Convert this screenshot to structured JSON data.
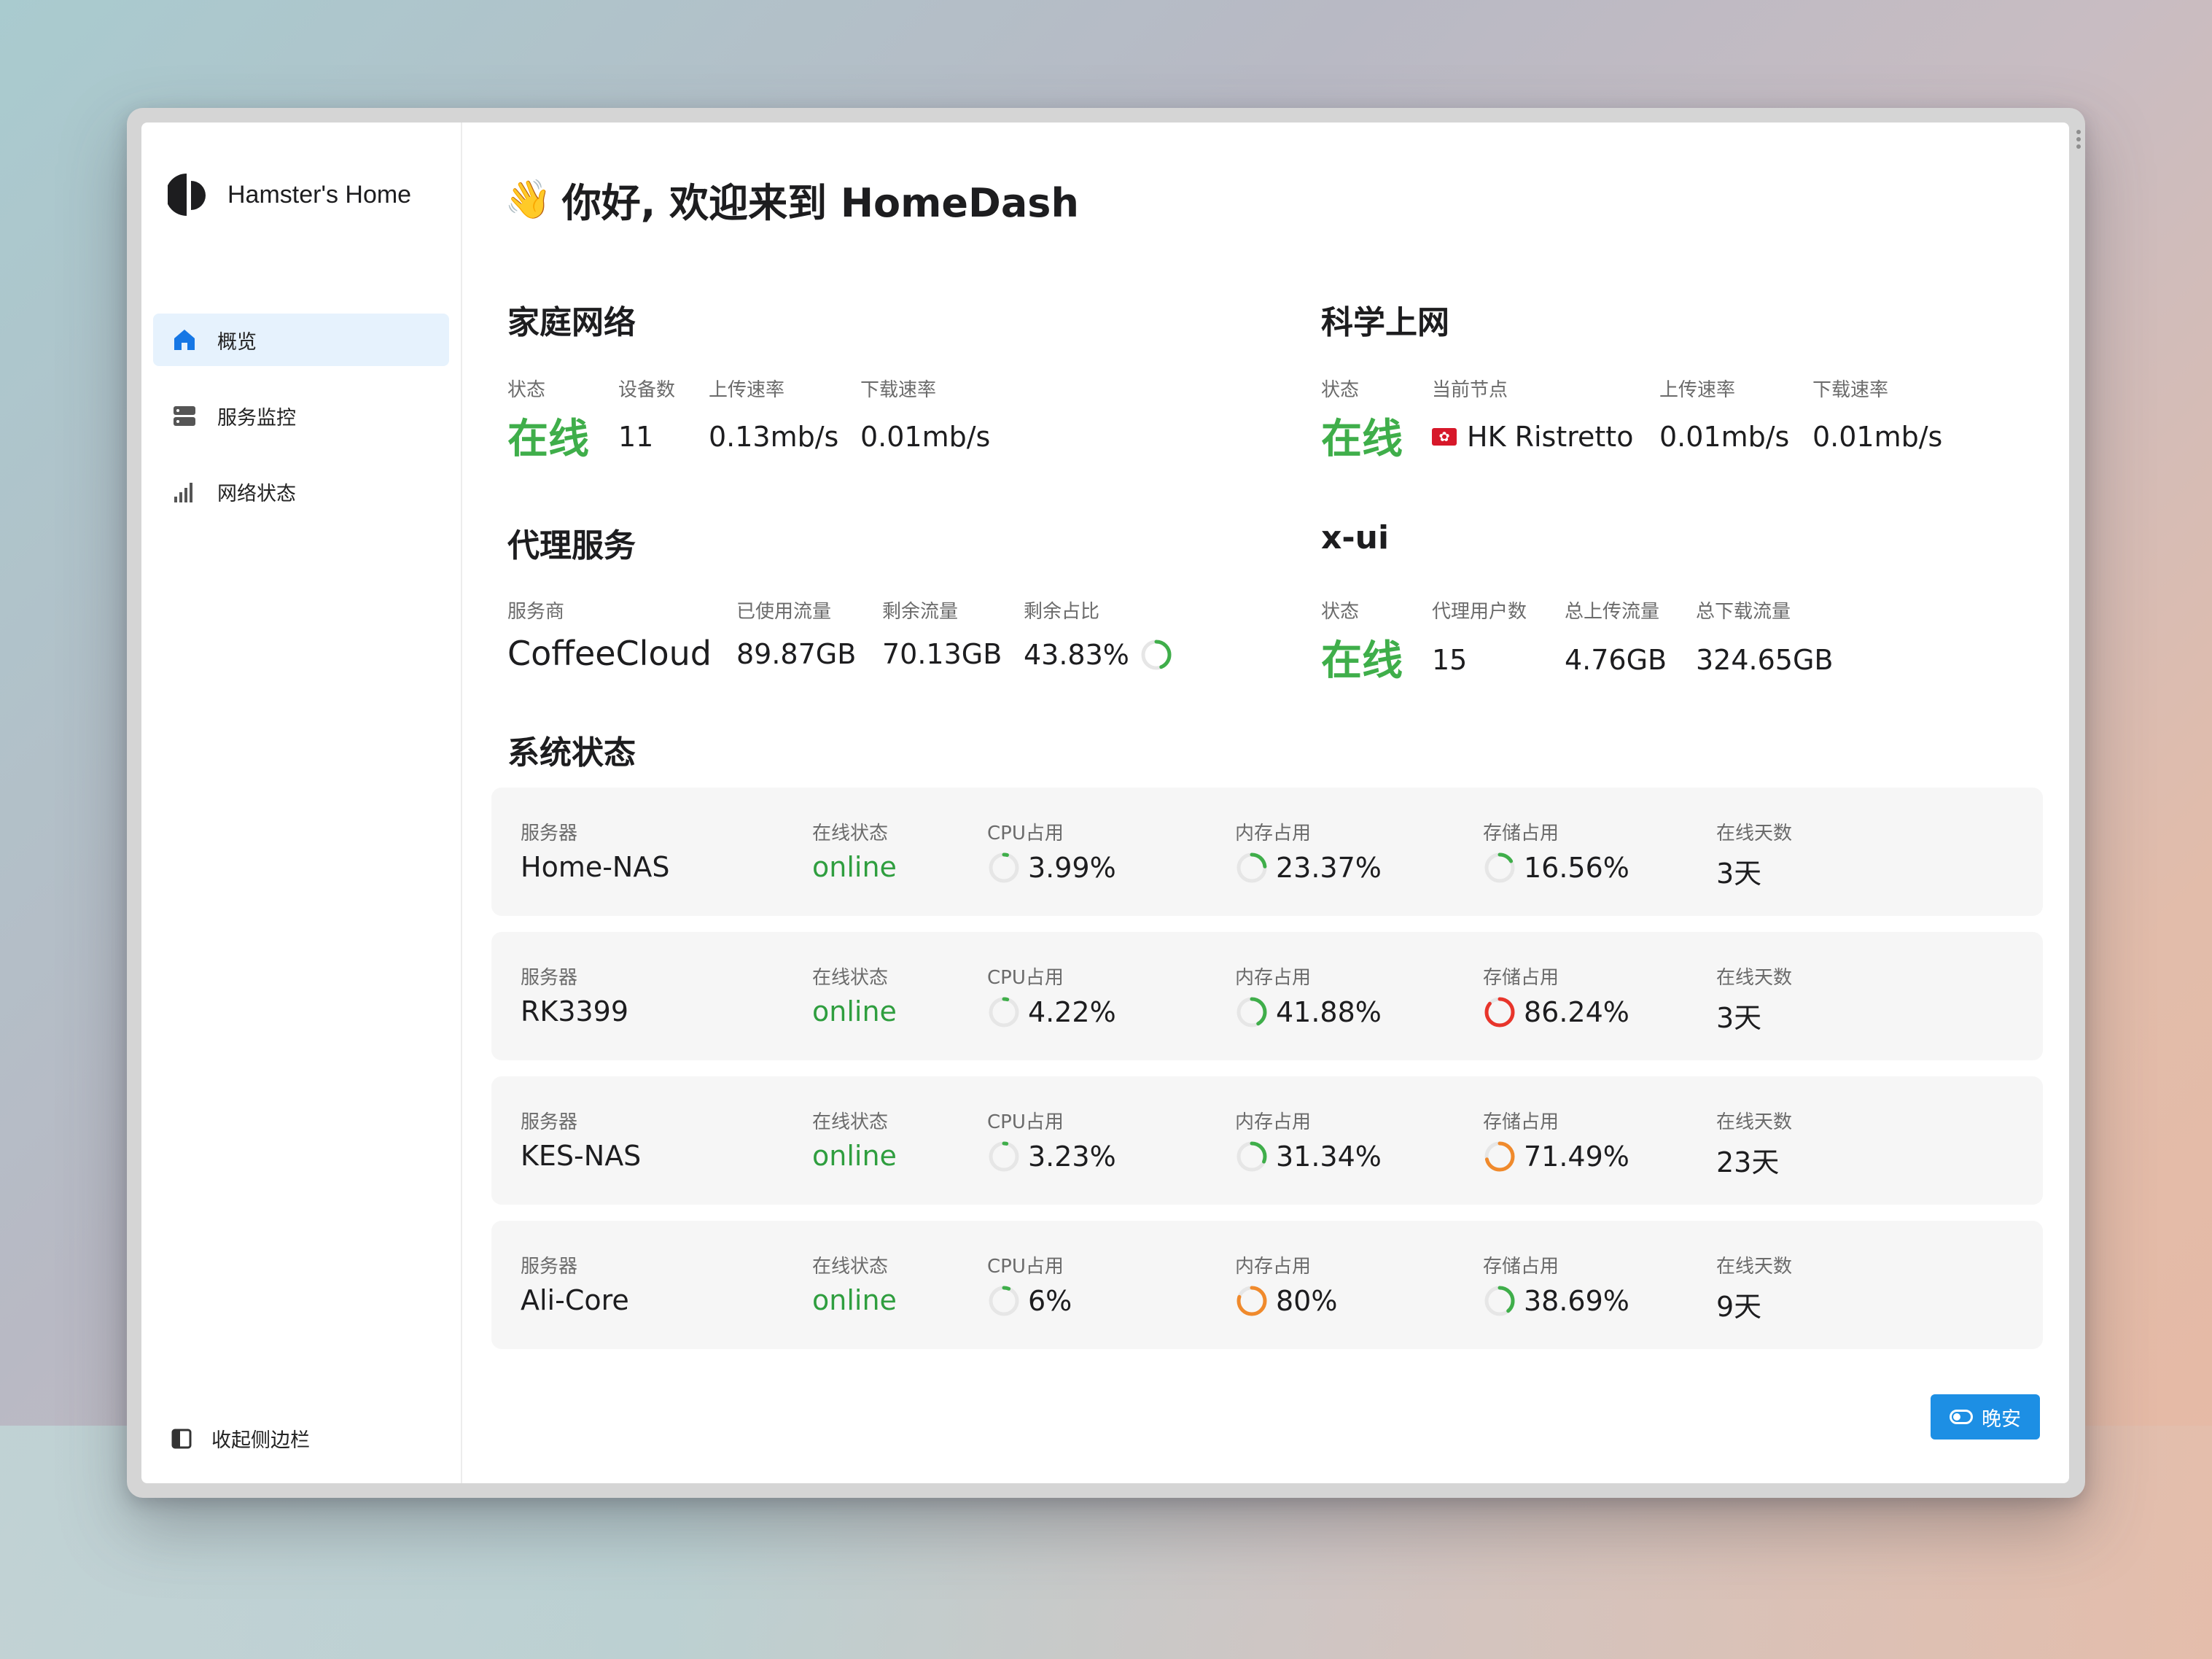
{
  "brand": {
    "name": "Hamster's Home"
  },
  "sidebar": {
    "items": [
      {
        "label": "概览",
        "icon": "home-icon"
      },
      {
        "label": "服务监控",
        "icon": "server-icon"
      },
      {
        "label": "网络状态",
        "icon": "signal-bars-icon"
      }
    ],
    "collapse_label": "收起侧边栏"
  },
  "greeting": {
    "emoji": "👋",
    "text": "你好, 欢迎来到 HomeDash"
  },
  "home_network": {
    "title": "家庭网络",
    "status_label": "状态",
    "status_value": "在线",
    "devices_label": "设备数",
    "devices_value": "11",
    "upload_label": "上传速率",
    "upload_value": "0.13mb/s",
    "download_label": "下载速率",
    "download_value": "0.01mb/s"
  },
  "science_net": {
    "title": "科学上网",
    "status_label": "状态",
    "status_value": "在线",
    "node_label": "当前节点",
    "node_value": "HK Ristretto",
    "upload_label": "上传速率",
    "upload_value": "0.01mb/s",
    "download_label": "下载速率",
    "download_value": "0.01mb/s"
  },
  "proxy": {
    "title": "代理服务",
    "provider_label": "服务商",
    "provider_value": "CoffeeCloud",
    "used_label": "已使用流量",
    "used_value": "89.87GB",
    "remain_label": "剩余流量",
    "remain_value": "70.13GB",
    "ratio_label": "剩余占比",
    "ratio_value": "43.83%",
    "ratio_fraction": 0.4383
  },
  "xui": {
    "title": "x-ui",
    "status_label": "状态",
    "status_value": "在线",
    "users_label": "代理用户数",
    "users_value": "15",
    "up_label": "总上传流量",
    "up_value": "4.76GB",
    "down_label": "总下载流量",
    "down_value": "324.65GB"
  },
  "system": {
    "title": "系统状态",
    "labels": {
      "server": "服务器",
      "online": "在线状态",
      "cpu": "CPU占用",
      "mem": "内存占用",
      "disk": "存储占用",
      "days": "在线天数"
    },
    "servers": [
      {
        "name": "Home-NAS",
        "status": "online",
        "cpu": "3.99%",
        "cpu_f": 0.0399,
        "mem": "23.37%",
        "mem_f": 0.2337,
        "disk": "16.56%",
        "disk_f": 0.1656,
        "days": "3天"
      },
      {
        "name": "RK3399",
        "status": "online",
        "cpu": "4.22%",
        "cpu_f": 0.0422,
        "mem": "41.88%",
        "mem_f": 0.4188,
        "disk": "86.24%",
        "disk_f": 0.8624,
        "days": "3天"
      },
      {
        "name": "KES-NAS",
        "status": "online",
        "cpu": "3.23%",
        "cpu_f": 0.0323,
        "mem": "31.34%",
        "mem_f": 0.3134,
        "disk": "71.49%",
        "disk_f": 0.7149,
        "days": "23天"
      },
      {
        "name": "Ali-Core",
        "status": "online",
        "cpu": "6%",
        "cpu_f": 0.06,
        "mem": "80%",
        "mem_f": 0.8,
        "disk": "38.69%",
        "disk_f": 0.3869,
        "days": "9天"
      }
    ]
  },
  "theme_button": {
    "label": "晚安"
  },
  "colors": {
    "accent": "#1d8fe4",
    "green": "#3fae4a",
    "orange": "#f08a2c",
    "red": "#e8352b"
  }
}
